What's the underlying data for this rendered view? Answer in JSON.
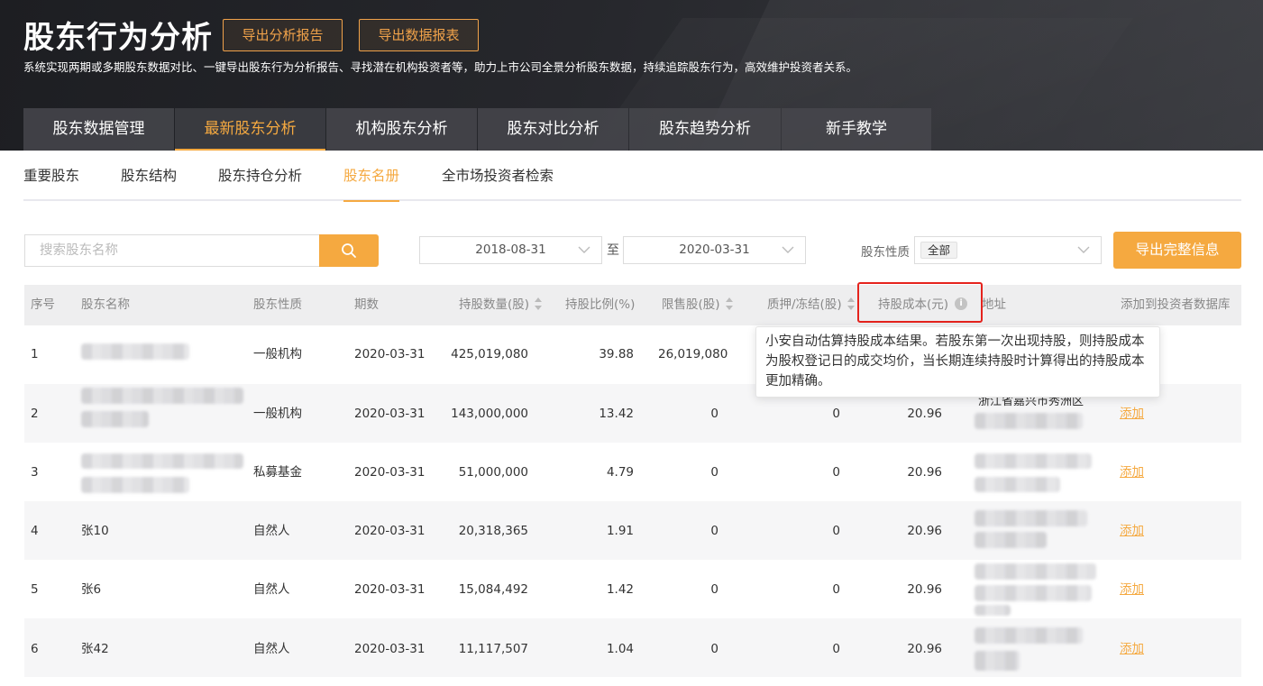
{
  "header": {
    "title": "股东行为分析",
    "export_report_label": "导出分析报告",
    "export_data_label": "导出数据报表",
    "subtitle": "系统实现两期或多期股东数据对比、一键导出股东行为分析报告、寻找潜在机构投资者等，助力上市公司全景分析股东数据，持续追踪股东行为，高效维护投资者关系。"
  },
  "main_tabs": [
    {
      "label": "股东数据管理",
      "active": false
    },
    {
      "label": "最新股东分析",
      "active": true
    },
    {
      "label": "机构股东分析",
      "active": false
    },
    {
      "label": "股东对比分析",
      "active": false
    },
    {
      "label": "股东趋势分析",
      "active": false
    },
    {
      "label": "新手教学",
      "active": false
    }
  ],
  "sub_tabs": [
    {
      "label": "重要股东",
      "active": false
    },
    {
      "label": "股东结构",
      "active": false
    },
    {
      "label": "股东持仓分析",
      "active": false
    },
    {
      "label": "股东名册",
      "active": true
    },
    {
      "label": "全市场投资者检索",
      "active": false
    }
  ],
  "filters": {
    "search_placeholder": "搜索股东名称",
    "start_date": "2018-08-31",
    "date_separator": "至",
    "end_date": "2020-03-31",
    "property_label": "股东性质",
    "property_selected": "全部",
    "export_full_label": "导出完整信息"
  },
  "table": {
    "headers": {
      "index": "序号",
      "name": "股东名称",
      "property": "股东性质",
      "period": "期数",
      "shares": "持股数量(股)",
      "ratio": "持股比例(%)",
      "restricted": "限售股(股)",
      "pledged": "质押/冻结(股)",
      "cost": "持股成本(元)",
      "address": "地址",
      "add_to_db": "添加到投资者数据库"
    },
    "rows": [
      {
        "index": "1",
        "name": "",
        "property": "一般机构",
        "period": "2020-03-31",
        "shares": "425,019,080",
        "ratio": "39.88",
        "restricted": "26,019,080",
        "pledged": "",
        "cost": "",
        "address": "",
        "action": ""
      },
      {
        "index": "2",
        "name": "",
        "property": "一般机构",
        "period": "2020-03-31",
        "shares": "143,000,000",
        "ratio": "13.42",
        "restricted": "0",
        "pledged": "0",
        "cost": "20.96",
        "address": "浙江省嘉兴市秀洲区",
        "action": "添加"
      },
      {
        "index": "3",
        "name": "",
        "property": "私募基金",
        "period": "2020-03-31",
        "shares": "51,000,000",
        "ratio": "4.79",
        "restricted": "0",
        "pledged": "0",
        "cost": "20.96",
        "address": "",
        "action": "添加"
      },
      {
        "index": "4",
        "name": "张10",
        "property": "自然人",
        "period": "2020-03-31",
        "shares": "20,318,365",
        "ratio": "1.91",
        "restricted": "0",
        "pledged": "0",
        "cost": "20.96",
        "address": "",
        "action": "添加"
      },
      {
        "index": "5",
        "name": "张6",
        "property": "自然人",
        "period": "2020-03-31",
        "shares": "15,084,492",
        "ratio": "1.42",
        "restricted": "0",
        "pledged": "0",
        "cost": "20.96",
        "address": "",
        "action": "添加"
      },
      {
        "index": "6",
        "name": "张42",
        "property": "自然人",
        "period": "2020-03-31",
        "shares": "11,117,507",
        "ratio": "1.04",
        "restricted": "0",
        "pledged": "0",
        "cost": "20.96",
        "address": "",
        "action": "添加"
      }
    ]
  },
  "tooltip": {
    "text": "小安自动估算持股成本结果。若股东第一次出现持股，则持股成本为股权登记日的成交均价，当长期连续持股时计算得出的持股成本更加精确。"
  },
  "colors": {
    "accent": "#f5a940",
    "highlight_border": "#e5231d"
  }
}
